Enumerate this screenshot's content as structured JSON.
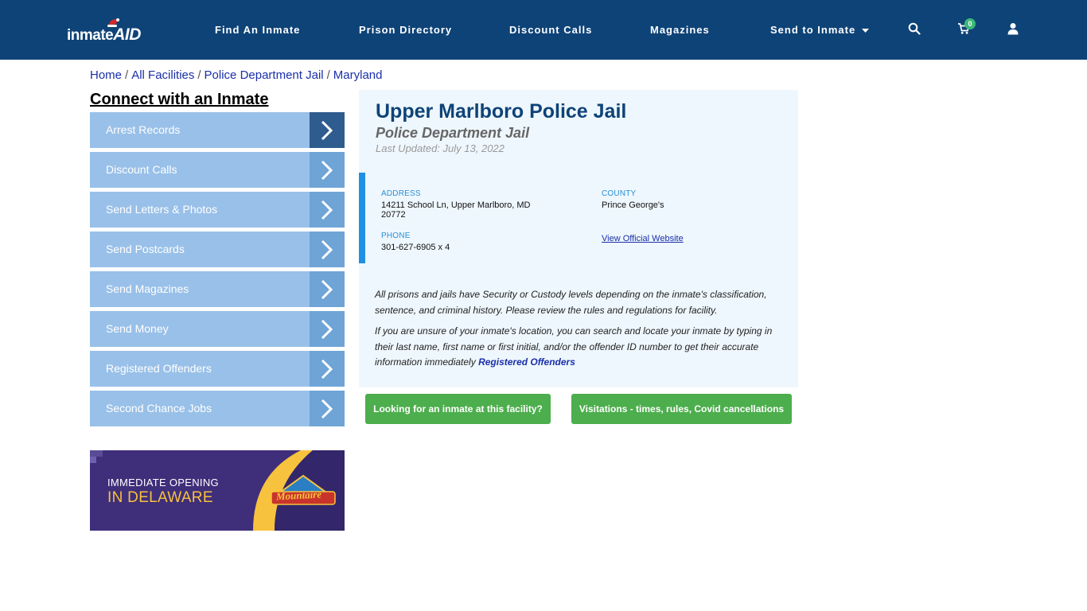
{
  "header": {
    "logo": {
      "part1": "inmate",
      "part2": "AID"
    },
    "nav": [
      {
        "label": "Find An Inmate"
      },
      {
        "label": "Prison Directory"
      },
      {
        "label": "Discount Calls"
      },
      {
        "label": "Magazines"
      },
      {
        "label": "Send to Inmate"
      }
    ],
    "cart_count": "0",
    "icons": [
      "search-icon",
      "cart-icon",
      "user-icon",
      "caret-down-icon"
    ]
  },
  "breadcrumb": [
    {
      "label": "Home"
    },
    {
      "label": "All Facilities"
    },
    {
      "label": "Police Department Jail"
    },
    {
      "label": "Maryland"
    }
  ],
  "breadcrumb_sep": "/",
  "sidebar": {
    "title": "Connect with an Inmate",
    "items": [
      {
        "label": "Arrest Records"
      },
      {
        "label": "Discount Calls"
      },
      {
        "label": "Send Letters & Photos"
      },
      {
        "label": "Send Postcards"
      },
      {
        "label": "Send Magazines"
      },
      {
        "label": "Send Money"
      },
      {
        "label": "Registered Offenders"
      },
      {
        "label": "Second Chance Jobs"
      }
    ]
  },
  "ad": {
    "line1": "IMMEDIATE OPENING",
    "line2": "IN DELAWARE",
    "brand": "Mountaire"
  },
  "facility": {
    "name": "Upper Marlboro Police Jail",
    "type": "Police Department Jail",
    "last_updated": "Last Updated: July 13, 2022",
    "address_label": "ADDRESS",
    "address_line1": "14211 School Ln, Upper Marlboro, MD",
    "address_line2": "20772",
    "county_label": "COUNTY",
    "county": "Prince George's",
    "phone_label": "PHONE",
    "phone": "301-627-6905 x 4",
    "website_link": "View Official Website"
  },
  "description": {
    "para1": "All prisons and jails have Security or Custody levels depending on the inmate's classification, sentence, and criminal history. Please review the rules and regulations for facility.",
    "para2": "If you are unsure of your inmate's location, you can search and locate your inmate by typing in their last name, first name or first initial, and/or the offender ID number to get their accurate information immediately",
    "para2_link": "Registered Offenders"
  },
  "buttons": {
    "find_inmate": "Looking for an inmate at this facility?",
    "visitations": "Visitations - times, rules, Covid cancellations"
  },
  "colors": {
    "header_bg": "#0e4377",
    "side_item": "#99c0e8",
    "accent_blue": "#1e90e6",
    "button_green": "#4cae4c",
    "ad_bg": "#3f2e7a"
  }
}
